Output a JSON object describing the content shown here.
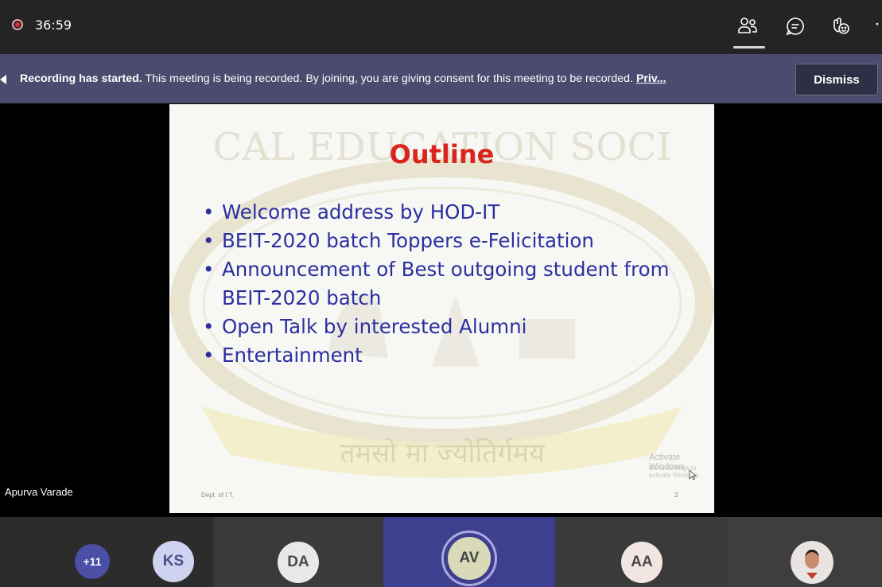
{
  "toolbar": {
    "timer": "36:59",
    "icons": [
      "recording-indicator",
      "people-icon",
      "chat-icon",
      "reactions-icon",
      "more-icon"
    ],
    "more_label": "·"
  },
  "banner": {
    "bold_text": "Recording has started.",
    "message": " This meeting is being recorded. By joining, you are giving consent for this meeting to be recorded. ",
    "link_text": "Priv...",
    "dismiss_label": "Dismiss"
  },
  "slide": {
    "title": "Outline",
    "bullets": [
      "Welcome address by HOD-IT",
      "BEIT-2020 batch Toppers e-Felicitation",
      "Announcement of Best outgoing student from BEIT-2020 batch",
      "Open Talk by interested Alumni",
      "Entertainment"
    ],
    "footer_left": "Dept. of I.T.",
    "page_number": "2",
    "watermark_text": "CAL EDUCATION SOCI",
    "watermark_motto": "तमसो मा ज्योतिर्गमय",
    "activate_title": "Activate Windows",
    "activate_sub": "Go to Settings to activate Windows."
  },
  "presenter_name": "Apurva Varade",
  "participants": {
    "overflow": "+11",
    "tiles": [
      "KS",
      "DA",
      "AV",
      "AA"
    ]
  },
  "colors": {
    "topbar": "#242424",
    "banner": "#4a4b6e",
    "title_red": "#d9261c",
    "bullet_blue": "#2b2fa0",
    "active_tile": "#3f3f8f"
  }
}
